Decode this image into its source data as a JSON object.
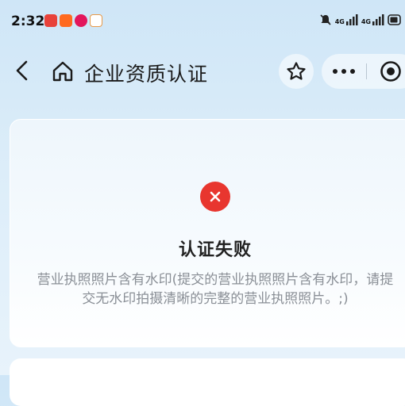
{
  "status_bar": {
    "time": "2:32",
    "network_1": "4G",
    "network_2": "4G",
    "icons": [
      "app-icon-red",
      "app-icon-orange",
      "app-icon-pink",
      "app-icon-mascot",
      "mute-icon",
      "signal-icon",
      "battery-icon"
    ]
  },
  "nav": {
    "title": "企业资质认证",
    "icons": [
      "back-arrow-icon",
      "home-icon",
      "star-icon",
      "more-dots-icon",
      "target-icon"
    ]
  },
  "result": {
    "title": "认证失败",
    "message": "营业执照照片含有水印(提交的营业执照照片含有水印，请提交无水印拍摄清晰的完整的营业执照照片。;)",
    "icon": "close-icon",
    "status_color": "#e8362f"
  }
}
